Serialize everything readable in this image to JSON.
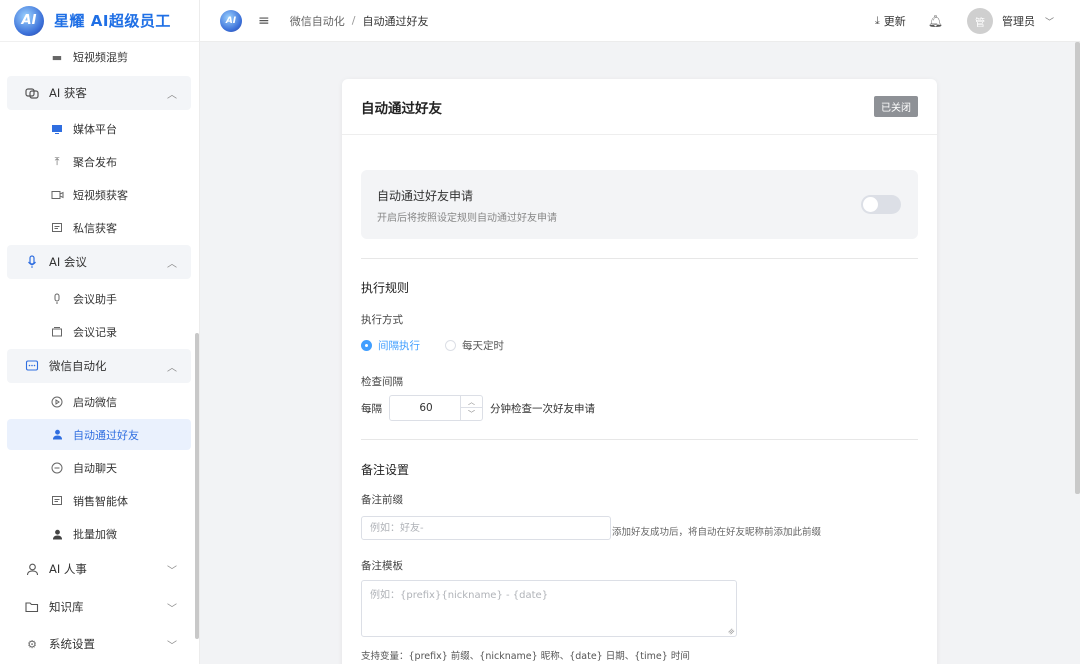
{
  "app": {
    "logo_text": "AI",
    "name": "星耀 AI超级员工",
    "brand_color": "#1f6fe5"
  },
  "sidebar": {
    "items": [
      {
        "label": "短视频混剪",
        "icon": "video-camera-icon",
        "level": "sub"
      },
      {
        "label": "AI 获客",
        "icon": "link-icon",
        "level": "top",
        "expanded": true
      },
      {
        "label": "媒体平台",
        "icon": "monitor-icon",
        "level": "sub"
      },
      {
        "label": "聚合发布",
        "icon": "upload-icon",
        "level": "sub"
      },
      {
        "label": "短视频获客",
        "icon": "video-icon",
        "level": "sub"
      },
      {
        "label": "私信获客",
        "icon": "message-icon",
        "level": "sub"
      },
      {
        "label": "AI 会议",
        "icon": "microphone-icon",
        "level": "top",
        "expanded": true
      },
      {
        "label": "会议助手",
        "icon": "microphone-icon",
        "level": "sub"
      },
      {
        "label": "会议记录",
        "icon": "folder-icon",
        "level": "sub"
      },
      {
        "label": "微信自动化",
        "icon": "chat-icon",
        "level": "top",
        "expanded": true
      },
      {
        "label": "启动微信",
        "icon": "play-circle-icon",
        "level": "sub"
      },
      {
        "label": "自动通过好友",
        "icon": "user-icon",
        "level": "sub",
        "active": true
      },
      {
        "label": "自动聊天",
        "icon": "chat-dots-icon",
        "level": "sub"
      },
      {
        "label": "销售智能体",
        "icon": "message-icon",
        "level": "sub"
      },
      {
        "label": "批量加微",
        "icon": "user-icon",
        "level": "sub"
      },
      {
        "label": "AI 人事",
        "icon": "person-icon",
        "level": "top",
        "expanded": false
      },
      {
        "label": "知识库",
        "icon": "folder-open-icon",
        "level": "top",
        "expanded": false
      },
      {
        "label": "系统设置",
        "icon": "gear-icon",
        "level": "top",
        "expanded": false
      }
    ]
  },
  "header": {
    "breadcrumb": [
      "微信自动化",
      "自动通过好友"
    ],
    "breadcrumb_sep": "/",
    "update_label": "更新",
    "user_name": "管理员",
    "avatar_text": "管"
  },
  "card": {
    "title": "自动通过好友",
    "status_badge": "已关闭",
    "switch": {
      "title": "自动通过好友申请",
      "desc": "开启后将按照设定规则自动通过好友申请",
      "enabled": false
    },
    "exec": {
      "section": "执行规则",
      "mode_label": "执行方式",
      "modes": [
        {
          "label": "间隔执行",
          "selected": true
        },
        {
          "label": "每天定时",
          "selected": false
        }
      ],
      "interval_label": "检查间隔",
      "every_prefix": "每隔",
      "interval_value": "60",
      "every_suffix": "分钟检查一次好友申请"
    },
    "remark": {
      "section": "备注设置",
      "prefix_label": "备注前缀",
      "prefix_placeholder": "例如：好友-",
      "prefix_hint": "添加好友成功后，将自动在好友昵称前添加此前缀",
      "template_label": "备注模板",
      "template_placeholder": "例如：{prefix}{nickname} - {date}",
      "vars_hint": "支持变量：{prefix} 前缀、{nickname} 昵称、{date} 日期、{time} 时间"
    }
  },
  "colors": {
    "accent": "#409eff",
    "active_menu_bg": "#eaf1fd",
    "badge_bg": "#8e9196"
  }
}
